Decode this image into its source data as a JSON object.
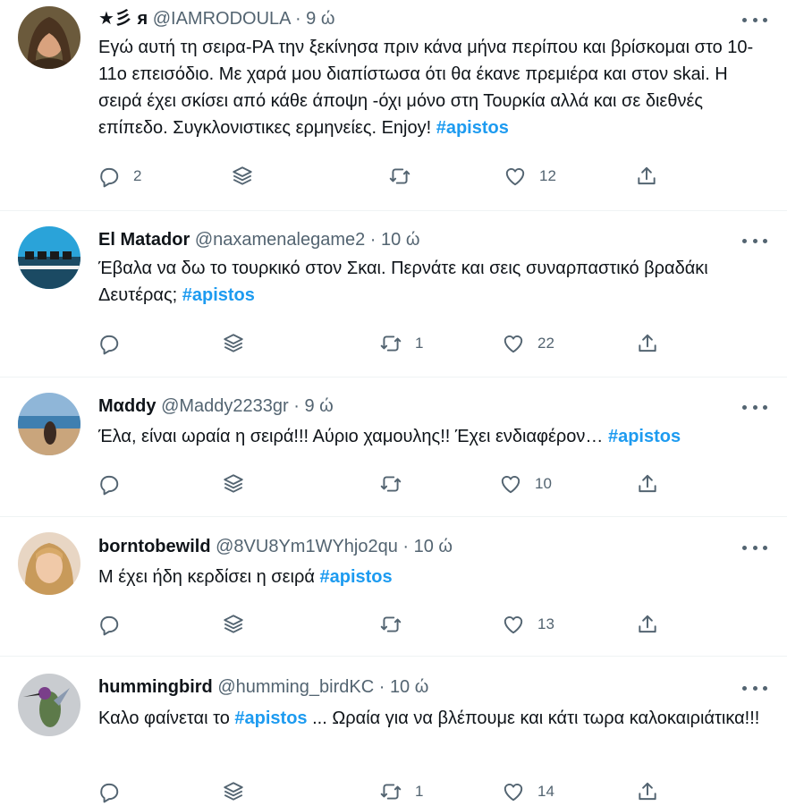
{
  "tweets": [
    {
      "name": "★彡 я",
      "handle": "@IAMRODOULA",
      "time": "9 ώ",
      "text_before": "Εγώ αυτή τη σειρα-ΡΑ την ξεκίνησα πριν κάνα μήνα περίπου και βρίσκομαι στο 10-11ο επεισόδιο. Με χαρά μου διαπίστωσα ότι θα έκανε πρεμιέρα και στον skai. Η σειρά έχει σκίσει από κάθε άποψη -όχι μόνο στη Τουρκία αλλά και σε διεθνές επίπεδο. Συγκλονιστικες ερμηνείες. Enjoy! ",
      "hashtag": "#apistos",
      "text_after": "",
      "replies": "2",
      "retweets": "",
      "likes": "12"
    },
    {
      "name": "El Matador",
      "handle": "@naxamenalegame2",
      "time": "10 ώ",
      "text_before": "Έβαλα να δω το τουρκικό στον Σκαι. Περνάτε και σεις συναρπαστικό βραδάκι Δευτέρας; ",
      "hashtag": "#apistos",
      "text_after": "",
      "replies": "",
      "retweets": "1",
      "likes": "22"
    },
    {
      "name": "Μαddy",
      "handle": "@Maddy2233gr",
      "time": "9 ώ",
      "text_before": "Έλα, είναι ωραία η σειρά!!! Αύριο χαμουλης!! Έχει ενδιαφέρον… ",
      "hashtag": "#apistos",
      "text_after": "",
      "replies": "",
      "retweets": "",
      "likes": "10"
    },
    {
      "name": "borntobewild",
      "handle": "@8VU8Ym1WYhjo2qu",
      "time": "10 ώ",
      "text_before": "Μ έχει ήδη κερδίσει η σειρά ",
      "hashtag": "#apistos",
      "text_after": "",
      "replies": "",
      "retweets": "",
      "likes": "13"
    },
    {
      "name": "hummingbird",
      "handle": "@humming_birdKC",
      "time": "10 ώ",
      "text_before": "Καλο φαίνεται το ",
      "hashtag": "#apistos",
      "text_after": " ... Ωραία για να βλέπουμε και κάτι τωρα καλοκαιριάτικα!!!",
      "replies": "",
      "retweets": "1",
      "likes": "14"
    }
  ],
  "separator": " · ",
  "colors": {
    "hashtag": "#1d9bf0",
    "muted": "#536471",
    "text": "#0f1419"
  },
  "icons": [
    "reply-icon",
    "stack-icon",
    "retweet-icon",
    "like-icon",
    "share-icon",
    "more-icon"
  ]
}
